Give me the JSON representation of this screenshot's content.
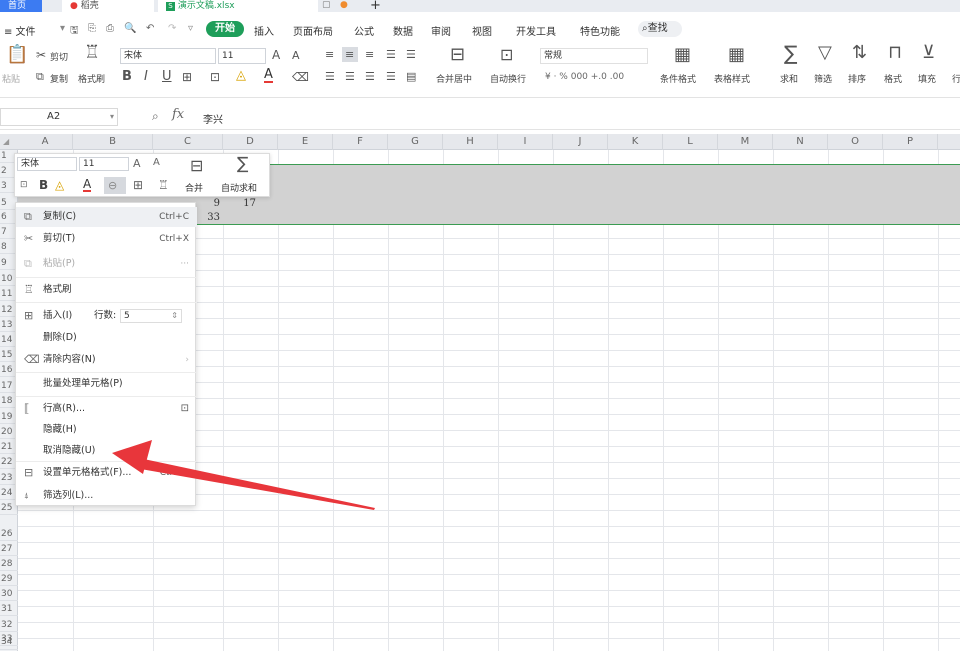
{
  "tabs": {
    "home": "首页",
    "docer": "稻壳",
    "file": "演示文稿.xlsx",
    "add": "+"
  },
  "menubar": {
    "file": "≡ 文件",
    "start": "开始",
    "items": [
      "插入",
      "页面布局",
      "公式",
      "数据",
      "审阅",
      "视图",
      "开发工具",
      "特色功能"
    ],
    "search": "查找"
  },
  "ribbon": {
    "paste": "粘贴",
    "cut": "剪切",
    "copy": "复制",
    "format_painter": "格式刷",
    "font_name": "宋体",
    "font_size": "11",
    "merge_center": "合并居中",
    "wrap": "自动换行",
    "number_format": "常规",
    "currency_row": "¥ · % 000 +.0 .00",
    "cond_format": "条件格式",
    "table_style": "表格样式",
    "sum": "求和",
    "filter": "筛选",
    "sort": "排序",
    "format": "格式",
    "fill": "填充",
    "row_col": "行"
  },
  "formula_bar": {
    "name_box": "A2",
    "fx": "fx",
    "value": "李兴"
  },
  "columns": [
    "A",
    "B",
    "C",
    "D",
    "E",
    "F",
    "G",
    "H",
    "I",
    "J",
    "K",
    "L",
    "M",
    "N",
    "O",
    "P"
  ],
  "rows": [
    "1",
    "2",
    "3",
    "5",
    "6",
    "7",
    "8",
    "9",
    "10",
    "11",
    "12",
    "13",
    "14",
    "15",
    "16",
    "17",
    "18",
    "19",
    "20",
    "21",
    "22",
    "23",
    "24",
    "25",
    "26",
    "27",
    "28",
    "29",
    "30",
    "31",
    "32",
    "33",
    "34"
  ],
  "cells": {
    "c5": "9",
    "d5": "17",
    "c6": "33"
  },
  "mini_toolbar": {
    "font": "宋体",
    "size": "11",
    "merge": "合并",
    "autosum": "自动求和"
  },
  "context_menu": {
    "copy": "复制(C)",
    "copy_sc": "Ctrl+C",
    "cut": "剪切(T)",
    "cut_sc": "Ctrl+X",
    "paste": "粘贴(P)",
    "paste_sc": "···",
    "format_painter": "格式刷",
    "insert": "插入(I)",
    "insert_rows_label": "行数:",
    "insert_rows_value": "5",
    "delete": "删除(D)",
    "clear": "清除内容(N)",
    "batch": "批量处理单元格(P)",
    "row_height": "行高(R)...",
    "hide": "隐藏(H)",
    "unhide": "取消隐藏(U)",
    "format_cells": "设置单元格格式(F)...",
    "format_cells_sc": "Ctrl+1",
    "filter_col": "筛选列(L)..."
  },
  "colors": {
    "accent_green": "#1e9e5a",
    "selection": "#d2d2d2",
    "arrow": "#e8363b",
    "tab_blue": "#3c7bf2"
  }
}
